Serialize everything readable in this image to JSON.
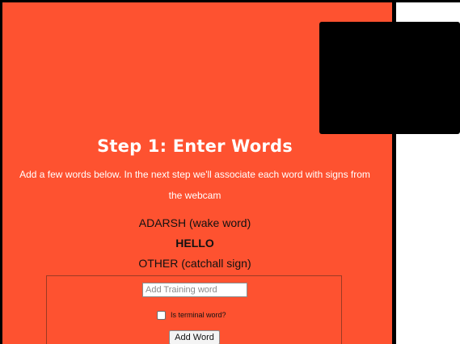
{
  "step": {
    "title": "Step 1: Enter Words",
    "description": "Add a few words below. In the next step we'll associate each word with signs from the webcam"
  },
  "words": [
    {
      "label": "ADARSH (wake word)",
      "bold": false
    },
    {
      "label": "HELLO",
      "bold": true
    },
    {
      "label": "OTHER (catchall sign)",
      "bold": false
    }
  ],
  "training": {
    "input_placeholder": "Add Training word",
    "input_value": "",
    "terminal_label": "Is terminal word?",
    "terminal_checked": false,
    "add_button_label": "Add Word"
  },
  "colors": {
    "panel_background": "#fe5230",
    "right_panel": "#ffffff",
    "webcam": "#000000"
  }
}
